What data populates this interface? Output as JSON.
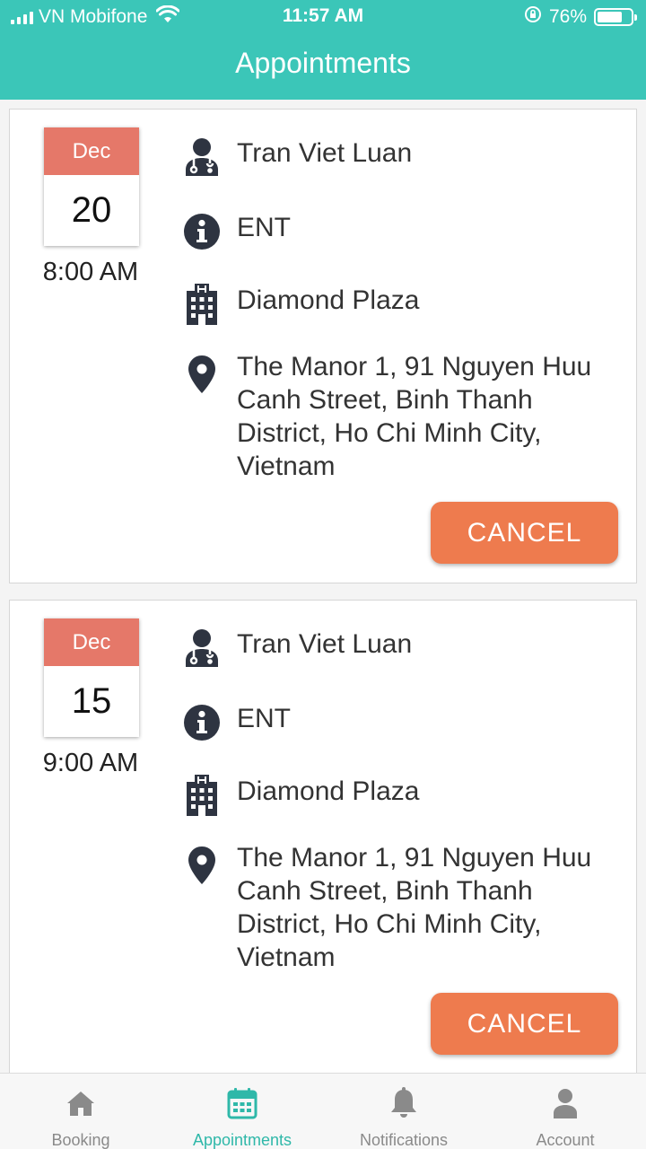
{
  "status": {
    "carrier": "VN Mobifone",
    "time": "11:57 AM",
    "battery": "76%",
    "battery_level": 0.76
  },
  "header": {
    "title": "Appointments"
  },
  "appointments": [
    {
      "month": "Dec",
      "day": "20",
      "time": "8:00 AM",
      "doctor": "Tran Viet Luan",
      "department": "ENT",
      "hospital": "Diamond Plaza",
      "address": "The Manor 1, 91 Nguyen Huu Canh Street, Binh Thanh District, Ho Chi Minh City, Vietnam",
      "cancel_label": "CANCEL"
    },
    {
      "month": "Dec",
      "day": "15",
      "time": "9:00 AM",
      "doctor": "Tran Viet Luan",
      "department": "ENT",
      "hospital": "Diamond Plaza",
      "address": "The Manor 1, 91 Nguyen Huu Canh Street, Binh Thanh District, Ho Chi Minh City, Vietnam",
      "cancel_label": "CANCEL"
    }
  ],
  "tabs": [
    {
      "label": "Booking",
      "icon": "home-icon",
      "active": false
    },
    {
      "label": "Appointments",
      "icon": "calendar-icon",
      "active": true
    },
    {
      "label": "Notifications",
      "icon": "bell-icon",
      "active": false
    },
    {
      "label": "Account",
      "icon": "user-icon",
      "active": false
    }
  ],
  "colors": {
    "primary": "#3bc6b8",
    "month_badge": "#e57869",
    "cancel_button": "#ee7b4e",
    "icon": "#2e3441",
    "tab_active": "#2fb8a9",
    "tab_inactive": "#8a8a8a"
  }
}
